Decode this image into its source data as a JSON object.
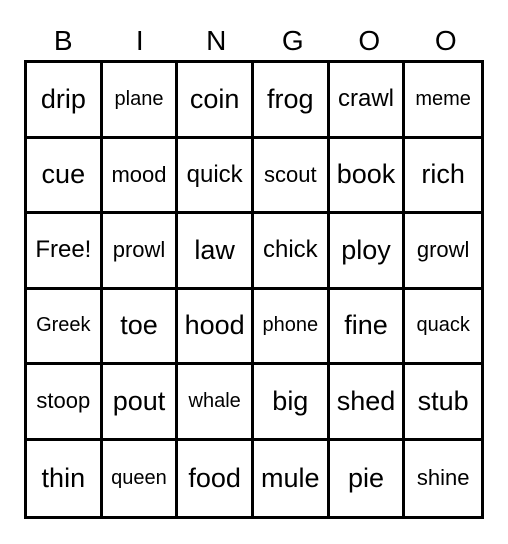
{
  "header": [
    "B",
    "I",
    "N",
    "G",
    "O",
    "O"
  ],
  "cells": [
    [
      "drip",
      "plane",
      "coin",
      "frog",
      "crawl",
      "meme"
    ],
    [
      "cue",
      "mood",
      "quick",
      "scout",
      "book",
      "rich"
    ],
    [
      "Free!",
      "prowl",
      "law",
      "chick",
      "ploy",
      "growl"
    ],
    [
      "Greek",
      "toe",
      "hood",
      "phone",
      "fine",
      "quack"
    ],
    [
      "stoop",
      "pout",
      "whale",
      "big",
      "shed",
      "stub"
    ],
    [
      "thin",
      "queen",
      "food",
      "mule",
      "pie",
      "shine"
    ]
  ]
}
